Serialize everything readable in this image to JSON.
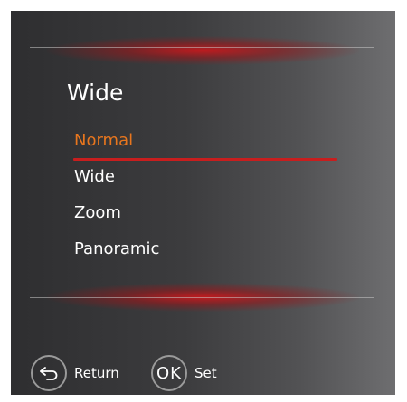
{
  "menu": {
    "title": "Wide",
    "items": [
      {
        "label": "Normal",
        "selected": true
      },
      {
        "label": "Wide",
        "selected": false
      },
      {
        "label": "Zoom",
        "selected": false
      },
      {
        "label": "Panoramic",
        "selected": false
      }
    ]
  },
  "footer": {
    "return_label": "Return",
    "ok_icon_text": "OK",
    "set_label": "Set",
    "return_icon": "return-arrow-icon"
  },
  "colors": {
    "selected_text": "#e8761e",
    "selection_underline": "#c81e1e",
    "glow": "#c8181c"
  }
}
